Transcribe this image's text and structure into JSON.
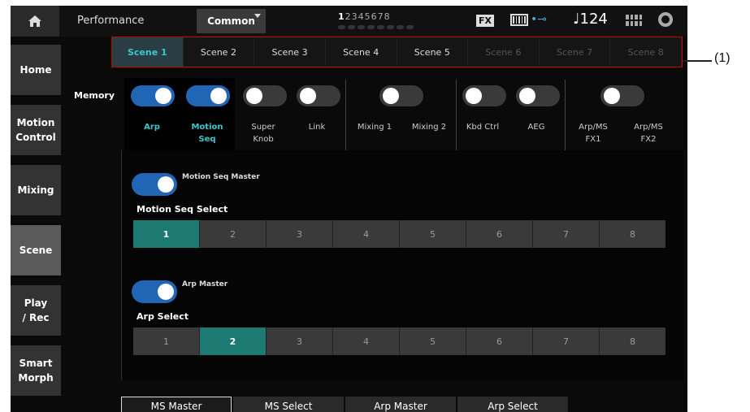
{
  "topbar": {
    "title": "Performance",
    "common_tab": "Common",
    "part_numbers_bold": "1",
    "part_numbers_rest": "2345678",
    "fx_label": "FX",
    "tempo": "♩124"
  },
  "sidebar": {
    "items": [
      {
        "label": "Home"
      },
      {
        "label": "Motion\nControl"
      },
      {
        "label": "Mixing"
      },
      {
        "label": "Scene"
      },
      {
        "label": "Play\n/ Rec"
      },
      {
        "label": "Smart\nMorph"
      }
    ]
  },
  "scene_tabs": [
    "Scene 1",
    "Scene 2",
    "Scene 3",
    "Scene 4",
    "Scene 5",
    "Scene 6",
    "Scene 7",
    "Scene 8"
  ],
  "memory": {
    "label": "Memory",
    "items": [
      {
        "label": "Arp",
        "on": true
      },
      {
        "label": "Motion\nSeq",
        "on": true
      },
      {
        "label": "Super\nKnob",
        "on": false
      },
      {
        "label": "Link",
        "on": false
      },
      {
        "label": "Mixing 1",
        "on": false
      },
      {
        "label": "Mixing 2",
        "on": false
      },
      {
        "label": "Kbd Ctrl",
        "on": false
      },
      {
        "label": "AEG",
        "on": false
      },
      {
        "label": "Arp/MS\nFX1",
        "on": false
      },
      {
        "label": "Arp/MS\nFX2",
        "on": false
      }
    ]
  },
  "motion_seq": {
    "master_label": "Motion Seq Master",
    "select_label": "Motion Seq Select",
    "options": [
      "1",
      "2",
      "3",
      "4",
      "5",
      "6",
      "7",
      "8"
    ],
    "selected": "1"
  },
  "arp": {
    "master_label": "Arp Master",
    "select_label": "Arp Select",
    "options": [
      "1",
      "2",
      "3",
      "4",
      "5",
      "6",
      "7",
      "8"
    ],
    "selected": "2"
  },
  "bottom_tabs": [
    "MS Master",
    "MS Select",
    "Arp Master",
    "Arp Select"
  ],
  "callout": "(1)",
  "colors": {
    "accent_teal": "#3fc6cc",
    "toggle_on": "#2166b4",
    "segment_selected": "#1d7a73",
    "callout_frame": "#cc0000"
  }
}
